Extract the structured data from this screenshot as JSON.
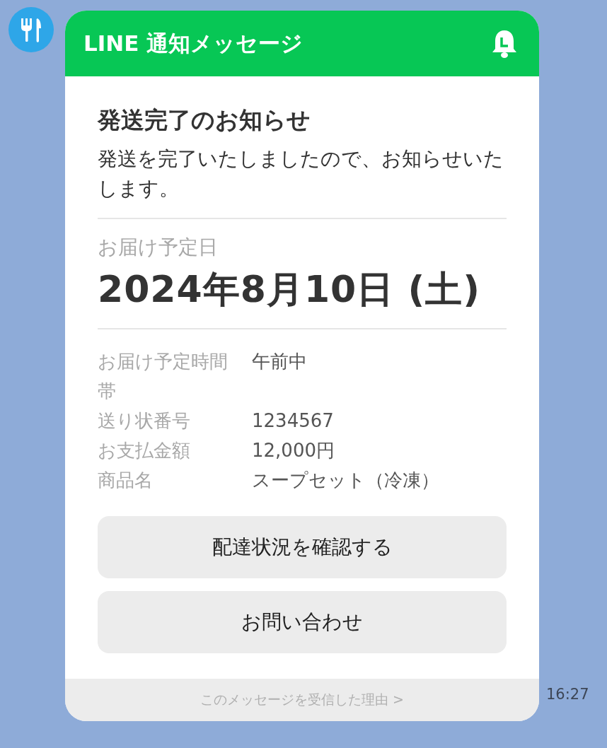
{
  "header": {
    "title": "LINE 通知メッセージ"
  },
  "message": {
    "title": "発送完了のお知らせ",
    "body": "発送を完了いたしましたので、お知らせいたします。"
  },
  "delivery": {
    "label": "お届け予定日",
    "date": "2024年8月10日 (土)"
  },
  "details": [
    {
      "label": "お届け予定時間帯",
      "value": "午前中"
    },
    {
      "label": "送り状番号",
      "value": "1234567"
    },
    {
      "label": "お支払金額",
      "value": "12,000円"
    },
    {
      "label": "商品名",
      "value": "スープセット（冷凍）"
    }
  ],
  "buttons": [
    "配達状況を確認する",
    "お問い合わせ"
  ],
  "footer_link": "このメッセージを受信した理由 >",
  "time": "16:27"
}
